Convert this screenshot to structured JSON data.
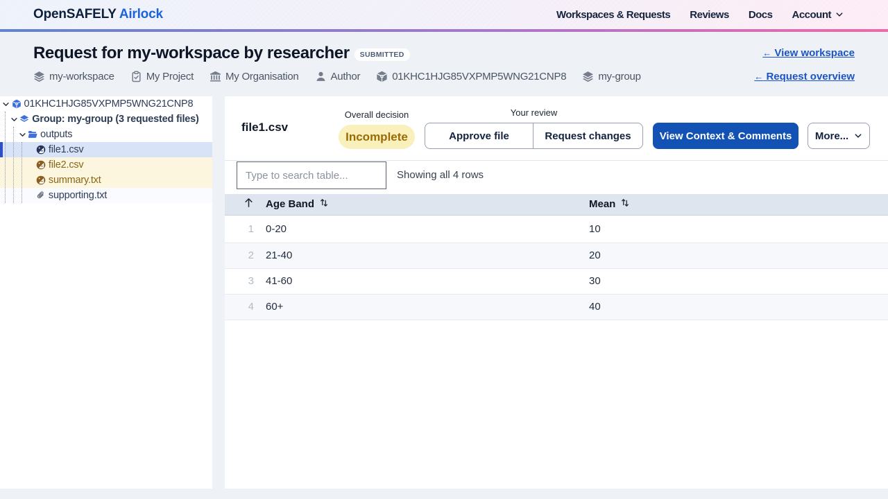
{
  "navbar": {
    "brand": {
      "primary": "OpenSAFELY",
      "secondary": "Airlock"
    },
    "items": [
      {
        "label": "Workspaces & Requests"
      },
      {
        "label": "Reviews"
      },
      {
        "label": "Docs"
      },
      {
        "label": "Account"
      }
    ]
  },
  "header": {
    "title": "Request for my-workspace by researcher",
    "status": "SUBMITTED",
    "links": [
      {
        "arrow": "←",
        "label": "View workspace"
      },
      {
        "arrow": "←",
        "label": "Request overview"
      }
    ],
    "meta": [
      {
        "icon": "layers-icon",
        "label": "my-workspace"
      },
      {
        "icon": "clipboard-check-icon",
        "label": "My Project"
      },
      {
        "icon": "building-columns-icon",
        "label": "My Organisation"
      },
      {
        "icon": "user-icon",
        "label": "Author"
      },
      {
        "icon": "cube-icon",
        "label": "01KHC1HJG85VXPMP5WNG21CNP8"
      },
      {
        "icon": "layers-icon",
        "label": "my-group"
      }
    ]
  },
  "sidebar": {
    "tree": [
      {
        "label": "01KHC1HJG85VXPMP5WNG21CNP8",
        "icon": "cube-icon",
        "level": 0,
        "expanded": true
      },
      {
        "label": "Group: my-group (3 requested files)",
        "icon": "layers-icon",
        "level": 1,
        "expanded": true,
        "bold": true
      },
      {
        "label": "outputs",
        "icon": "folder-open-icon",
        "level": 2,
        "expanded": true
      },
      {
        "label": "file1.csv",
        "icon": "file-review-icon",
        "level": 3,
        "state": "selected"
      },
      {
        "label": "file2.csv",
        "icon": "file-review-icon",
        "level": 3,
        "state": "output"
      },
      {
        "label": "summary.txt",
        "icon": "file-review-icon",
        "level": 3,
        "state": "output"
      },
      {
        "label": "supporting.txt",
        "icon": "paperclip-icon",
        "level": 3,
        "state": "supporting"
      }
    ]
  },
  "content": {
    "file_title": "file1.csv",
    "overall_decision_label": "Overall decision",
    "decision_value": "Incomplete",
    "your_review_label": "Your review",
    "approve_label": "Approve file",
    "request_changes_label": "Request changes",
    "view_context_label": "View Context & Comments",
    "more_label": "More...",
    "search_placeholder": "Type to search table...",
    "rows_status": "Showing all 4 rows"
  },
  "chart_data": {
    "type": "table",
    "columns": [
      "Age Band",
      "Mean"
    ],
    "rows": [
      {
        "n": "1",
        "age_band": "0-20",
        "mean": "10"
      },
      {
        "n": "2",
        "age_band": "21-40",
        "mean": "20"
      },
      {
        "n": "3",
        "age_band": "41-60",
        "mean": "30"
      },
      {
        "n": "4",
        "age_band": "60+",
        "mean": "40"
      }
    ]
  },
  "colors": {
    "accent_blue": "#1252b4",
    "selected_row": "#d8e3f8",
    "output_row": "#fcf6df",
    "badge_yellow": "#faf0bb",
    "gradient_left": "#6d8dd0",
    "gradient_right": "#ec6ba6"
  }
}
